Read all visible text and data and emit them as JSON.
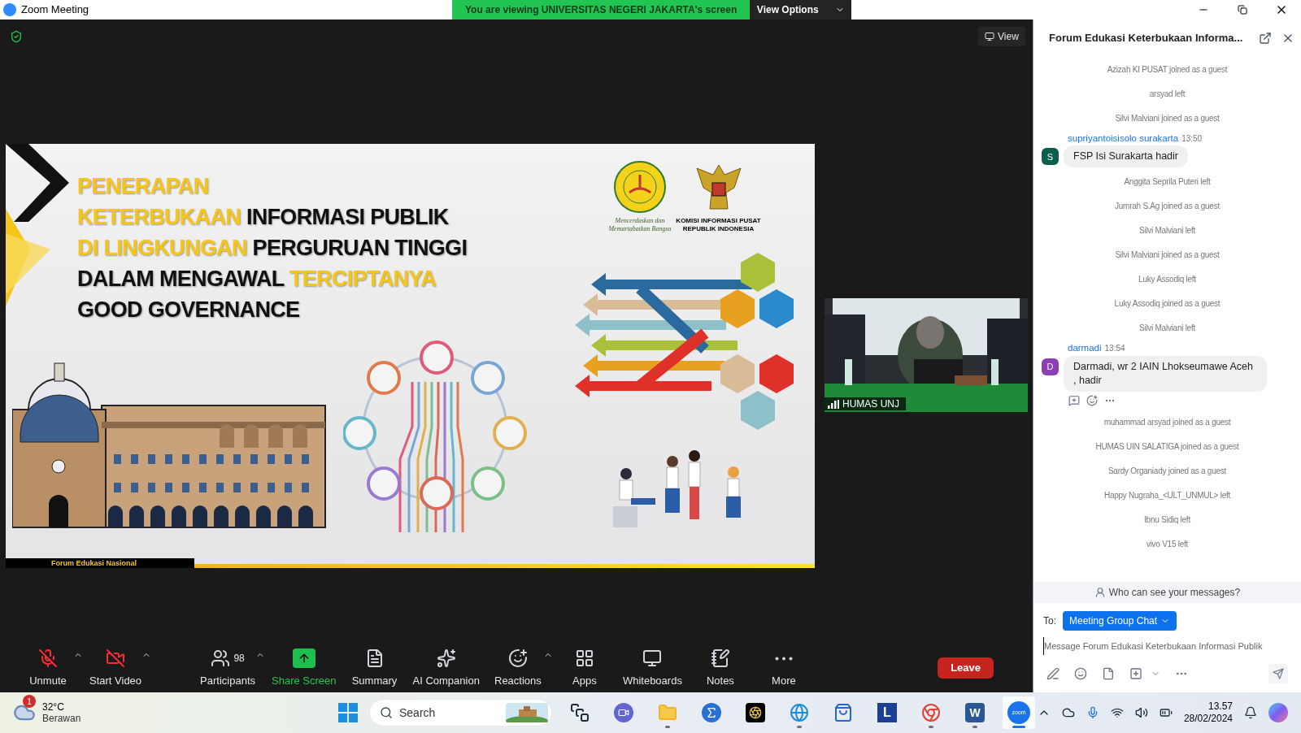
{
  "window": {
    "title": "Zoom Meeting",
    "banner": "You are viewing UNIVERSITAS NEGERI JAKARTA's screen",
    "view_options": "View Options"
  },
  "view_button": "View",
  "slide": {
    "title_lines": [
      {
        "segments": [
          {
            "text": "PENERAPAN",
            "highlight": true
          }
        ]
      },
      {
        "segments": [
          {
            "text": "KETERBUKAAN",
            "highlight": true
          },
          {
            "text": " INFORMASI PUBLIK",
            "highlight": false
          }
        ]
      },
      {
        "segments": [
          {
            "text": "DI LINGKUNGAN",
            "highlight": true
          },
          {
            "text": " PERGURUAN TINGGI",
            "highlight": false
          }
        ]
      },
      {
        "segments": [
          {
            "text": "DALAM MENGAWAL ",
            "highlight": false
          },
          {
            "text": "TERCIPTANYA",
            "highlight": true
          }
        ]
      },
      {
        "segments": [
          {
            "text": "GOOD GOVERNANCE",
            "highlight": false
          }
        ]
      }
    ],
    "logo_caption_1": "Mencerdaskan dan Memartabatkan Bangsa",
    "logo_caption_2": "KOMISI INFORMASI PUSAT",
    "logo_caption_3": "REPUBLIK INDONESIA",
    "footer": "Forum Edukasi Nasional"
  },
  "video_tile": {
    "name": "HUMAS UNJ"
  },
  "toolbar": [
    {
      "kind": "mic",
      "label": "Unmute",
      "caret": true,
      "active": false
    },
    {
      "kind": "video",
      "label": "Start Video",
      "caret": true,
      "active": false
    },
    {
      "kind": "participants",
      "label": "Participants",
      "count": "98",
      "caret": true,
      "active": false
    },
    {
      "kind": "share",
      "label": "Share Screen",
      "caret": false,
      "active": true
    },
    {
      "kind": "summary",
      "label": "Summary",
      "caret": false,
      "active": false
    },
    {
      "kind": "ai",
      "label": "AI Companion",
      "caret": false,
      "active": false
    },
    {
      "kind": "reactions",
      "label": "Reactions",
      "caret": true,
      "active": false
    },
    {
      "kind": "apps",
      "label": "Apps",
      "caret": false,
      "active": false
    },
    {
      "kind": "whiteboards",
      "label": "Whiteboards",
      "caret": false,
      "active": false
    },
    {
      "kind": "notes",
      "label": "Notes",
      "caret": false,
      "active": false
    },
    {
      "kind": "more",
      "label": "More",
      "caret": false,
      "active": false
    }
  ],
  "leave_button": "Leave",
  "chat": {
    "title": "Forum Edukasi Keterbukaan Informa...",
    "items": [
      {
        "kind": "system",
        "text": "Azizah KI PUSAT joined as a guest"
      },
      {
        "kind": "system",
        "text": "arsyad left"
      },
      {
        "kind": "system",
        "text": "Silvi Malviani joined as a guest"
      },
      {
        "kind": "message",
        "author": "supriyantoisisolo surakarta",
        "time": "13:50",
        "avatar": "S",
        "color": "#0b5e4a",
        "text": "FSP Isi Surakarta hadir",
        "hovered": false
      },
      {
        "kind": "system",
        "text": "Anggita Seprila Puteri left"
      },
      {
        "kind": "system",
        "text": "Jumrah S.Ag joined as a guest"
      },
      {
        "kind": "system",
        "text": "Silvi Malviani left"
      },
      {
        "kind": "system",
        "text": "Silvi Malviani joined as a guest"
      },
      {
        "kind": "system",
        "text": "Luky Assodiq left"
      },
      {
        "kind": "system",
        "text": "Luky Assodiq joined as a guest"
      },
      {
        "kind": "system",
        "text": "Silvi Malviani left"
      },
      {
        "kind": "message",
        "author": "darmadi",
        "time": "13:54",
        "avatar": "D",
        "color": "#8e3fb5",
        "text": "Darmadi, wr 2 IAIN Lhokseumawe Aceh , hadir",
        "hovered": true
      },
      {
        "kind": "system",
        "text": "muhammad arsyad joined as a guest"
      },
      {
        "kind": "system",
        "text": "HUMAS UIN SALATIGA joined as a guest"
      },
      {
        "kind": "system",
        "text": "Sardy Organiady joined as a guest"
      },
      {
        "kind": "system",
        "text": "Happy Nugraha_<ULT_UNMUL> left"
      },
      {
        "kind": "system",
        "text": "Ibnu Sidiq left"
      },
      {
        "kind": "system",
        "text": "vivo V15 left"
      }
    ],
    "privacy_note": "Who can see your messages?",
    "to_label": "To:",
    "recipient": "Meeting Group Chat",
    "placeholder": "Message Forum Edukasi Keterbukaan Informasi Publik"
  },
  "taskbar": {
    "temperature": "32°C",
    "weather": "Berawan",
    "weather_badge": "1",
    "search_placeholder": "Search",
    "apps": [
      {
        "kind": "taskview",
        "running": false,
        "selected": false
      },
      {
        "kind": "meet",
        "running": false,
        "selected": false
      },
      {
        "kind": "folder",
        "running": true,
        "selected": false
      },
      {
        "kind": "sigma",
        "running": false,
        "selected": false
      },
      {
        "kind": "lens",
        "running": false,
        "selected": false
      },
      {
        "kind": "edge",
        "running": true,
        "selected": false
      },
      {
        "kind": "store",
        "running": false,
        "selected": false
      },
      {
        "kind": "letter",
        "text": "L",
        "running": false,
        "selected": false
      },
      {
        "kind": "chrome",
        "running": true,
        "selected": false
      },
      {
        "kind": "word",
        "text": "W",
        "running": true,
        "selected": false
      },
      {
        "kind": "zoom",
        "text": "zoom",
        "running": true,
        "selected": true
      }
    ],
    "time": "13.57",
    "date": "28/02/2024"
  }
}
